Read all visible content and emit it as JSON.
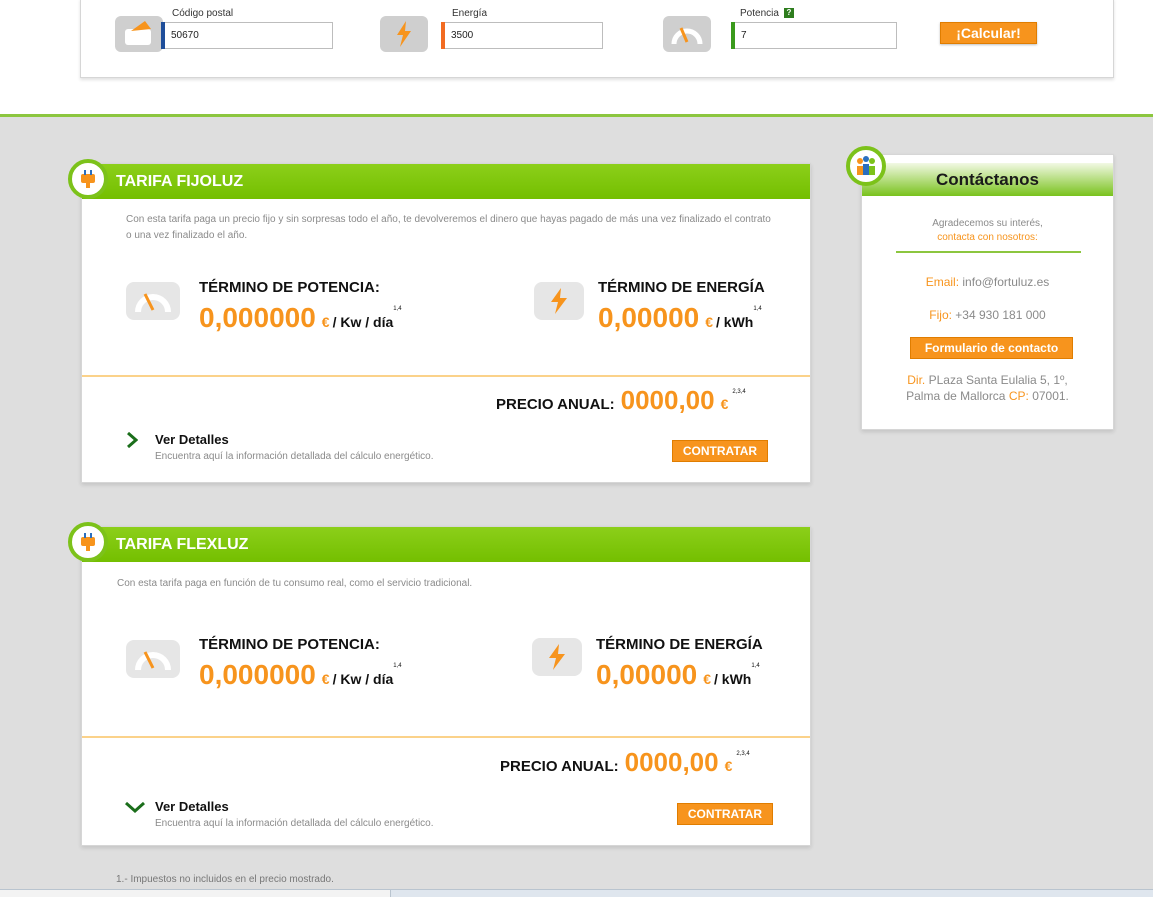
{
  "calculator": {
    "postal_label": "Código postal",
    "postal_value": "50670",
    "energy_label": "Energía",
    "energy_value": "3500",
    "power_label": "Potencia",
    "power_help": "?",
    "power_value": "7",
    "calc_button": "¡Calcular!"
  },
  "tariffs": [
    {
      "title": "TARIFA FIJOLUZ",
      "description": "Con esta tarifa paga un precio fijo y sin sorpresas todo el año, te devolveremos el dinero que hayas pagado de más una vez finalizado el contrato o una vez finalizado el año.",
      "power_title": "TÉRMINO DE POTENCIA:",
      "power_value": "0,000000",
      "power_currency": "€",
      "power_unit": "/ Kw / día",
      "power_note": "1,4",
      "energy_title": "TÉRMINO DE ENERGÍA",
      "energy_value": "0,00000",
      "energy_currency": "€",
      "energy_unit": "/ kWh",
      "energy_note": "1,4",
      "annual_label": "PRECIO ANUAL:",
      "annual_value": "0000,00",
      "annual_currency": "€",
      "annual_note": "2,3,4",
      "details_title": "Ver Detalles",
      "details_sub": "Encuentra aquí la información detallada del cálculo energético.",
      "contract_button": "CONTRATAR"
    },
    {
      "title": "TARIFA FLEXLUZ",
      "description": "Con esta tarifa paga en función de tu consumo real, como el servicio tradicional.",
      "power_title": "TÉRMINO DE POTENCIA:",
      "power_value": "0,000000",
      "power_currency": "€",
      "power_unit": "/ Kw / día",
      "power_note": "1,4",
      "energy_title": "TÉRMINO DE ENERGÍA",
      "energy_value": "0,00000",
      "energy_currency": "€",
      "energy_unit": "/ kWh",
      "energy_note": "1,4",
      "annual_label": "PRECIO ANUAL:",
      "annual_value": "0000,00",
      "annual_currency": "€",
      "annual_note": "2,3,4",
      "details_title": "Ver Detalles",
      "details_sub": "Encuentra aquí la información detallada del cálculo energético.",
      "contract_button": "CONTRATAR"
    }
  ],
  "contact": {
    "title": "Contáctanos",
    "thanks": "Agradecemos su interés,",
    "contact_us": "contacta con nosotros:",
    "email_label": "Email:",
    "email_value": "info@fortuluz.es",
    "phone_label": "Fijo:",
    "phone_value": "+34 930 181 000",
    "form_button": "Formulario de contacto",
    "dir_label": "Dir.",
    "dir_value": "PLaza Santa Eulalia 5, 1º,",
    "city": "Palma de Mallorca",
    "cp_label": "CP:",
    "cp_value": "07001."
  },
  "footnote": "1.- Impuestos no incluidos en el precio mostrado.",
  "colors": {
    "accent_green": "#7cc21a",
    "accent_orange": "#f7941d"
  }
}
